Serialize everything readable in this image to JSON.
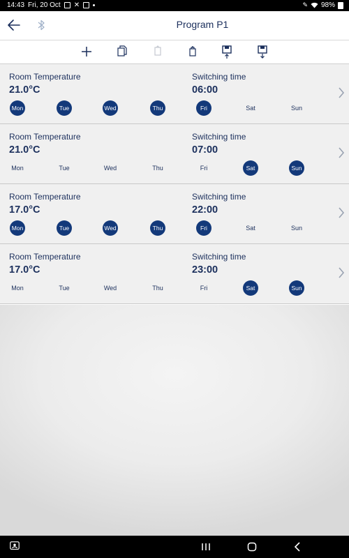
{
  "status_bar": {
    "time": "14:43",
    "date": "Fri, 20 Oct",
    "battery": "98%"
  },
  "header": {
    "title": "Program P1"
  },
  "toolbar": {
    "buttons": [
      "add-icon",
      "copy-icon",
      "paste-icon",
      "delete-icon",
      "upload-icon",
      "download-icon"
    ]
  },
  "days": [
    "Mon",
    "Tue",
    "Wed",
    "Thu",
    "Fri",
    "Sat",
    "Sun"
  ],
  "rows": [
    {
      "temp_label": "Room Temperature",
      "temp_value": "21.0°C",
      "time_label": "Switching time",
      "time_value": "06:00",
      "active": [
        true,
        true,
        true,
        true,
        true,
        false,
        false
      ]
    },
    {
      "temp_label": "Room Temperature",
      "temp_value": "21.0°C",
      "time_label": "Switching time",
      "time_value": "07:00",
      "active": [
        false,
        false,
        false,
        false,
        false,
        true,
        true
      ]
    },
    {
      "temp_label": "Room Temperature",
      "temp_value": "17.0°C",
      "time_label": "Switching time",
      "time_value": "22:00",
      "active": [
        true,
        true,
        true,
        true,
        true,
        false,
        false
      ]
    },
    {
      "temp_label": "Room Temperature",
      "temp_value": "17.0°C",
      "time_label": "Switching time",
      "time_value": "23:00",
      "active": [
        false,
        false,
        false,
        false,
        false,
        true,
        true
      ]
    }
  ],
  "colors": {
    "accent": "#13397a",
    "text": "#1b2f5c",
    "row_bg": "#f0f0f0"
  }
}
